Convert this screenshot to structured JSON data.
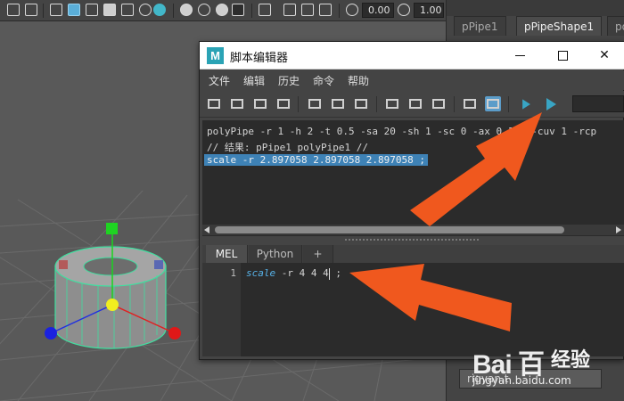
{
  "toolbar": {
    "field1_value": "0.00",
    "field2_value": "1.00"
  },
  "right_panel": {
    "tabs": [
      "pPipe1",
      "pPipeShape1",
      "po"
    ],
    "bottom_field": "rigyan.t"
  },
  "script_editor": {
    "window_title": "脚本编辑器",
    "logo_letter": "M",
    "close_symbol": "✕",
    "menu": [
      "文件",
      "编辑",
      "历史",
      "命令",
      "帮助"
    ],
    "history_lines": [
      "polyPipe -r 1 -h 2 -t 0.5 -sa 20 -sh 1 -sc 0 -ax 0 1 0 -cuv 1 -rcp",
      "// 结果: pPipe1 polyPipe1 //",
      "scale -r 2.897058 2.897058 2.897058 ;"
    ],
    "input_tabs": [
      "MEL",
      "Python",
      "+"
    ],
    "active_input_tab": "MEL",
    "line_number": "1",
    "code_keyword": "scale",
    "code_rest": " -r 4 4 4",
    "code_after_caret": " ;"
  },
  "watermark": {
    "logo": "Bai 百",
    "text": "经验",
    "url": "jingyan.baidu.com"
  },
  "colors": {
    "accent_blue": "#3e82b6",
    "play_cyan": "#39a5c4",
    "arrow_orange": "#f0581e",
    "mesh_green": "#3fe0a0"
  }
}
